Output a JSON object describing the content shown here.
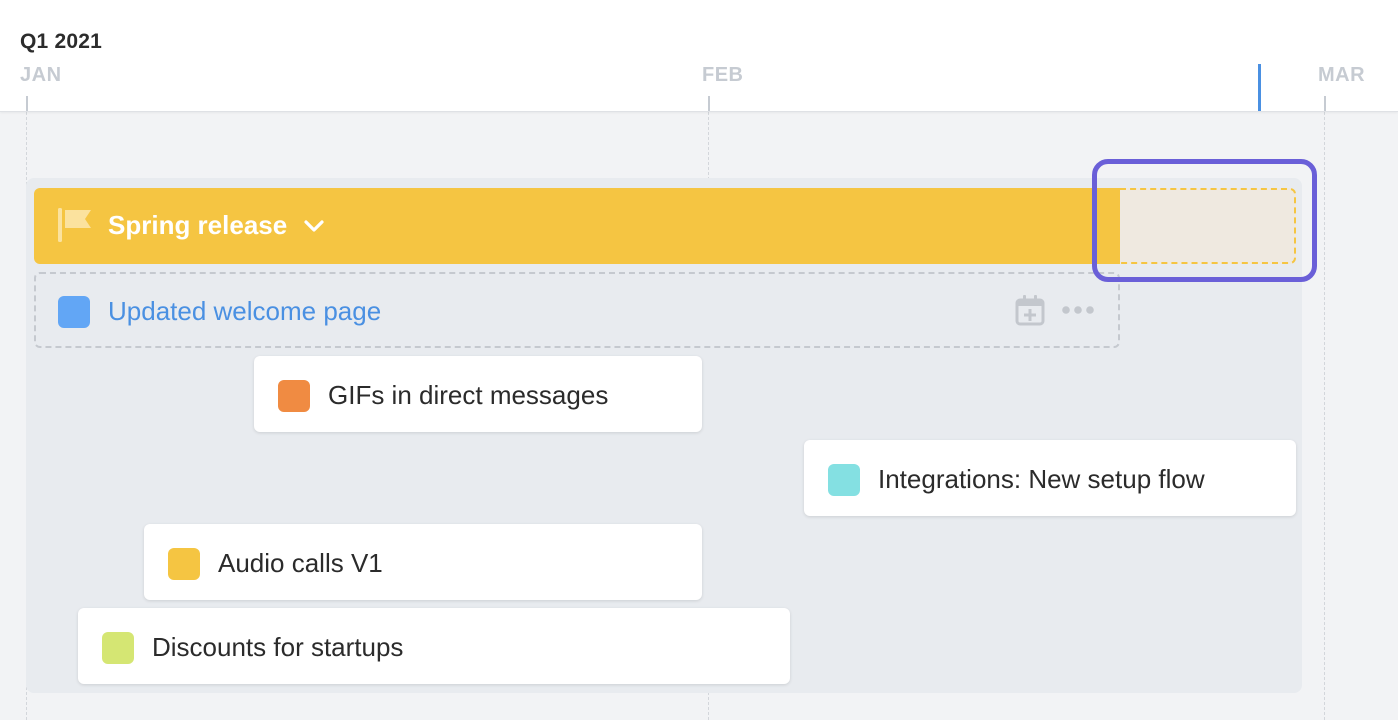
{
  "timeline": {
    "quarter": "Q1 2021",
    "months": [
      "JAN",
      "FEB",
      "MAR"
    ]
  },
  "release": {
    "title": "Spring release",
    "color": "#f5c542",
    "highlight_color": "#6a5fd8"
  },
  "empty_item": {
    "label": "Updated welcome page",
    "color": "#62a6f5"
  },
  "items": [
    {
      "label": "GIFs in direct messages",
      "color": "#f08b42"
    },
    {
      "label": "Integrations: New setup flow",
      "color": "#84e0e2"
    },
    {
      "label": "Audio calls V1",
      "color": "#f5c542"
    },
    {
      "label": "Discounts for startups",
      "color": "#d5e673"
    }
  ],
  "icons": {
    "release": "flag-icon",
    "toggle": "chevron-down-icon",
    "schedule": "calendar-plus-icon",
    "menu": "more-icon"
  }
}
